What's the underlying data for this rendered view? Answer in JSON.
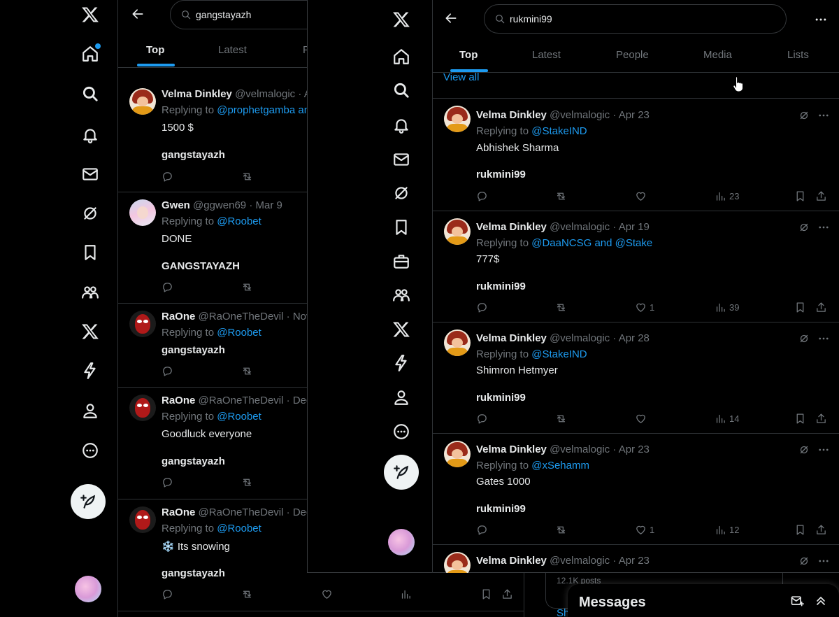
{
  "back": {
    "search": {
      "value": "gangstayazh"
    },
    "tabs": [
      {
        "label": "Top"
      },
      {
        "label": "Latest"
      },
      {
        "label": "P"
      }
    ],
    "tweets": [
      {
        "name": "Velma Dinkley",
        "handle": "@velmalogic",
        "date": "A",
        "reply_prefix": "Replying to",
        "reply_to": "@prophetgamba an",
        "text": "1500 $",
        "footer": "gangstayazh"
      },
      {
        "name": "Gwen",
        "handle": "@ggwen69",
        "date": "Mar 9",
        "reply_prefix": "Replying to",
        "reply_to": "@Roobet",
        "text": "DONE",
        "footer": "GANGSTAYAZH"
      },
      {
        "name": "RaOne",
        "handle": "@RaOneTheDevil",
        "date": "Nov",
        "reply_prefix": "Replying to",
        "reply_to": "@Roobet",
        "text": "",
        "footer": "gangstayazh"
      },
      {
        "name": "RaOne",
        "handle": "@RaOneTheDevil",
        "date": "Dec",
        "reply_prefix": "Replying to",
        "reply_to": "@Roobet",
        "text": "Goodluck everyone",
        "footer": "gangstayazh"
      },
      {
        "name": "RaOne",
        "handle": "@RaOneTheDevil",
        "date": "Dec",
        "reply_prefix": "Replying to",
        "reply_to": "@Roobet",
        "text": "❄️ Its snowing",
        "footer": "gangstayazh"
      }
    ],
    "posts_count": "12.1K posts",
    "show_more_partial": "Sh",
    "messages_title": "Messages"
  },
  "front": {
    "search": {
      "value": "rukmini99"
    },
    "tabs": [
      {
        "label": "Top"
      },
      {
        "label": "Latest"
      },
      {
        "label": "People"
      },
      {
        "label": "Media"
      },
      {
        "label": "Lists"
      }
    ],
    "view_all": "View all",
    "tweets": [
      {
        "name": "Velma Dinkley",
        "handle": "@velmalogic",
        "date": "Apr 23",
        "reply_prefix": "Replying to",
        "reply_to": "@StakeIND",
        "text": "Abhishek Sharma",
        "footer": "rukmini99",
        "likes": "",
        "views": "23"
      },
      {
        "name": "Velma Dinkley",
        "handle": "@velmalogic",
        "date": "Apr 19",
        "reply_prefix": "Replying to",
        "reply_to": "@DaaNCSG and @Stake",
        "text": "777$",
        "footer": "rukmini99",
        "likes": "1",
        "views": "39"
      },
      {
        "name": "Velma Dinkley",
        "handle": "@velmalogic",
        "date": "Apr 28",
        "reply_prefix": "Replying to",
        "reply_to": "@StakeIND",
        "text": "Shimron Hetmyer",
        "footer": "rukmini99",
        "likes": "",
        "views": "14"
      },
      {
        "name": "Velma Dinkley",
        "handle": "@velmalogic",
        "date": "Apr 23",
        "reply_prefix": "Replying to",
        "reply_to": "@xSehamm",
        "text": "Gates 1000",
        "footer": "rukmini99",
        "likes": "1",
        "views": "12"
      },
      {
        "name": "Velma Dinkley",
        "handle": "@velmalogic",
        "date": "Apr 23",
        "reply_prefix": "",
        "reply_to": "",
        "text": "",
        "footer": "",
        "likes": "",
        "views": ""
      }
    ]
  },
  "colors": {
    "accent": "#1d9bf0",
    "background": "#000000",
    "border": "#2f3336",
    "muted": "#71767b",
    "text": "#e7e9ea"
  },
  "icons": [
    "x-logo-icon",
    "home-icon",
    "search-icon",
    "bell-icon",
    "mail-icon",
    "grok-icon",
    "bookmark-icon",
    "jobs-icon",
    "communities-icon",
    "premium-icon",
    "verified-orgs-icon",
    "profile-icon",
    "more-icon",
    "compose-icon"
  ]
}
